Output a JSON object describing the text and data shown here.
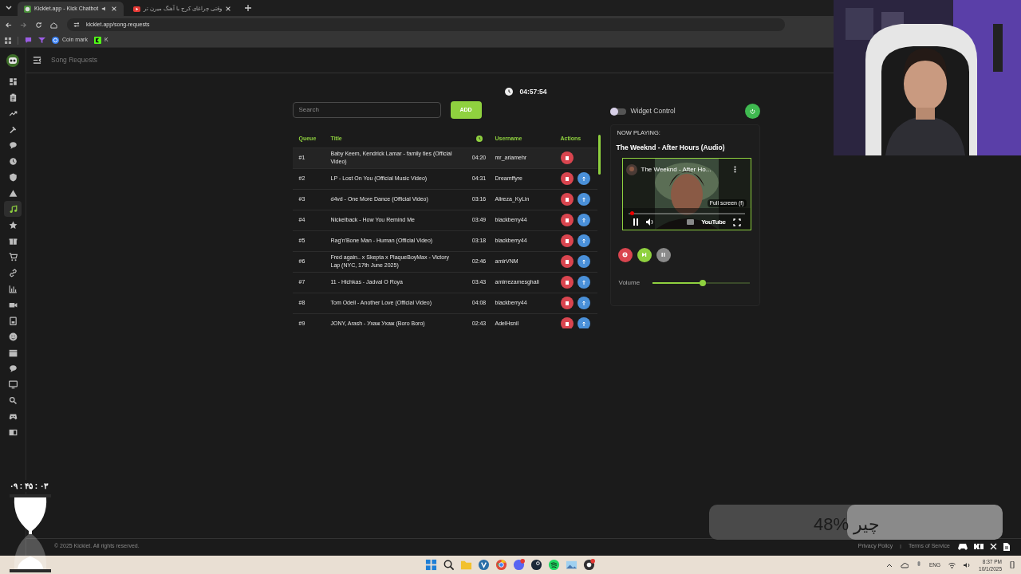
{
  "browser": {
    "tabs": [
      {
        "title": "Kicklet.app - Kick Chatbot",
        "selected": true
      },
      {
        "title": "وقتی چراغای کرج با آهنگ میرن تر",
        "selected": false
      }
    ],
    "url": "kicklet.app/song-requests",
    "bookmarks": [
      "Coin mark",
      "K"
    ]
  },
  "header": {
    "title": "Song Requests"
  },
  "sidebar": {
    "items": [
      {
        "selected": false
      },
      {
        "selected": false
      },
      {
        "selected": false
      },
      {
        "selected": false
      },
      {
        "selected": false
      },
      {
        "selected": false
      },
      {
        "selected": false
      },
      {
        "selected": false
      },
      {
        "selected": true
      },
      {
        "selected": false
      },
      {
        "selected": false
      },
      {
        "selected": false
      },
      {
        "selected": false
      },
      {
        "selected": false
      },
      {
        "selected": false
      },
      {
        "selected": false
      },
      {
        "selected": false
      },
      {
        "selected": false
      },
      {
        "selected": false
      },
      {
        "selected": false
      },
      {
        "selected": false
      },
      {
        "selected": false
      },
      {
        "selected": false
      }
    ]
  },
  "clock": "04:57:54",
  "search": {
    "placeholder": "Search"
  },
  "add_button": "ADD",
  "table": {
    "columns": [
      {
        "kind": "text",
        "label": "Queue"
      },
      {
        "kind": "text",
        "label": "Title"
      },
      {
        "kind": "clock"
      },
      {
        "kind": "text",
        "label": "Username"
      },
      {
        "kind": "text",
        "label": "Actions"
      }
    ],
    "rows": [
      {
        "queue": "#1",
        "title": "Baby Keem, Kendrick Lamar - family ties (Official Video)",
        "duration": "04:20",
        "username": "mr_ariamehr",
        "move_up": false
      },
      {
        "queue": "#2",
        "title": "LP - Lost On You (Official Music Video)",
        "duration": "04:31",
        "username": "Dreamffyre",
        "move_up": true
      },
      {
        "queue": "#3",
        "title": "d4vd - One More Dance (Official Video)",
        "duration": "03:16",
        "username": "Alireza_KyLin",
        "move_up": true
      },
      {
        "queue": "#4",
        "title": "Nickelback - How You Remind Me",
        "duration": "03:49",
        "username": "blackberry44",
        "move_up": true
      },
      {
        "queue": "#5",
        "title": "Rag'n'Bone Man - Human (Official Video)",
        "duration": "03:18",
        "username": "blackberry44",
        "move_up": true
      },
      {
        "queue": "#6",
        "title": "Fred again.. x Skepta x PlaqueBoyMax - Victory Lap (NYC, 17th June 2025)",
        "duration": "02:46",
        "username": "amirVNM",
        "move_up": true
      },
      {
        "queue": "#7",
        "title": "11 - Hichkas - Jadval O Roya",
        "duration": "03:43",
        "username": "amirrezamesghali",
        "move_up": true
      },
      {
        "queue": "#8",
        "title": "Tom Odell - Another Love (Official Video)",
        "duration": "04:08",
        "username": "blackberry44",
        "move_up": true
      },
      {
        "queue": "#9",
        "title": "JONY, Arash - Ухаж Ухаж (Boro Boro)",
        "duration": "02:43",
        "username": "AdelHsnil",
        "move_up": true
      }
    ]
  },
  "widget_control": {
    "label": "Widget Control",
    "on": false
  },
  "now_playing": {
    "heading": "NOW PLAYING:",
    "title": "The Weeknd - After Hours (Audio)",
    "video": {
      "title": "The Weeknd - After Ho...",
      "tooltip": "Full screen (f)",
      "logo": "YouTube"
    },
    "volume": {
      "label": "Volume",
      "level": 0.52
    }
  },
  "footer": {
    "copyright": "© 2025 Kicklet. All rights reserved.",
    "links": [
      "Privacy Policy",
      "Terms of Service"
    ],
    "separator": "|"
  },
  "overlays": {
    "timer": "۰۹ : ۴۵ : ۰۳",
    "progress": {
      "text": "48% چیر",
      "level": 0.53
    }
  },
  "taskbar": {
    "language": "ENG",
    "time": "8:37 PM",
    "date": "10/1/2025"
  }
}
